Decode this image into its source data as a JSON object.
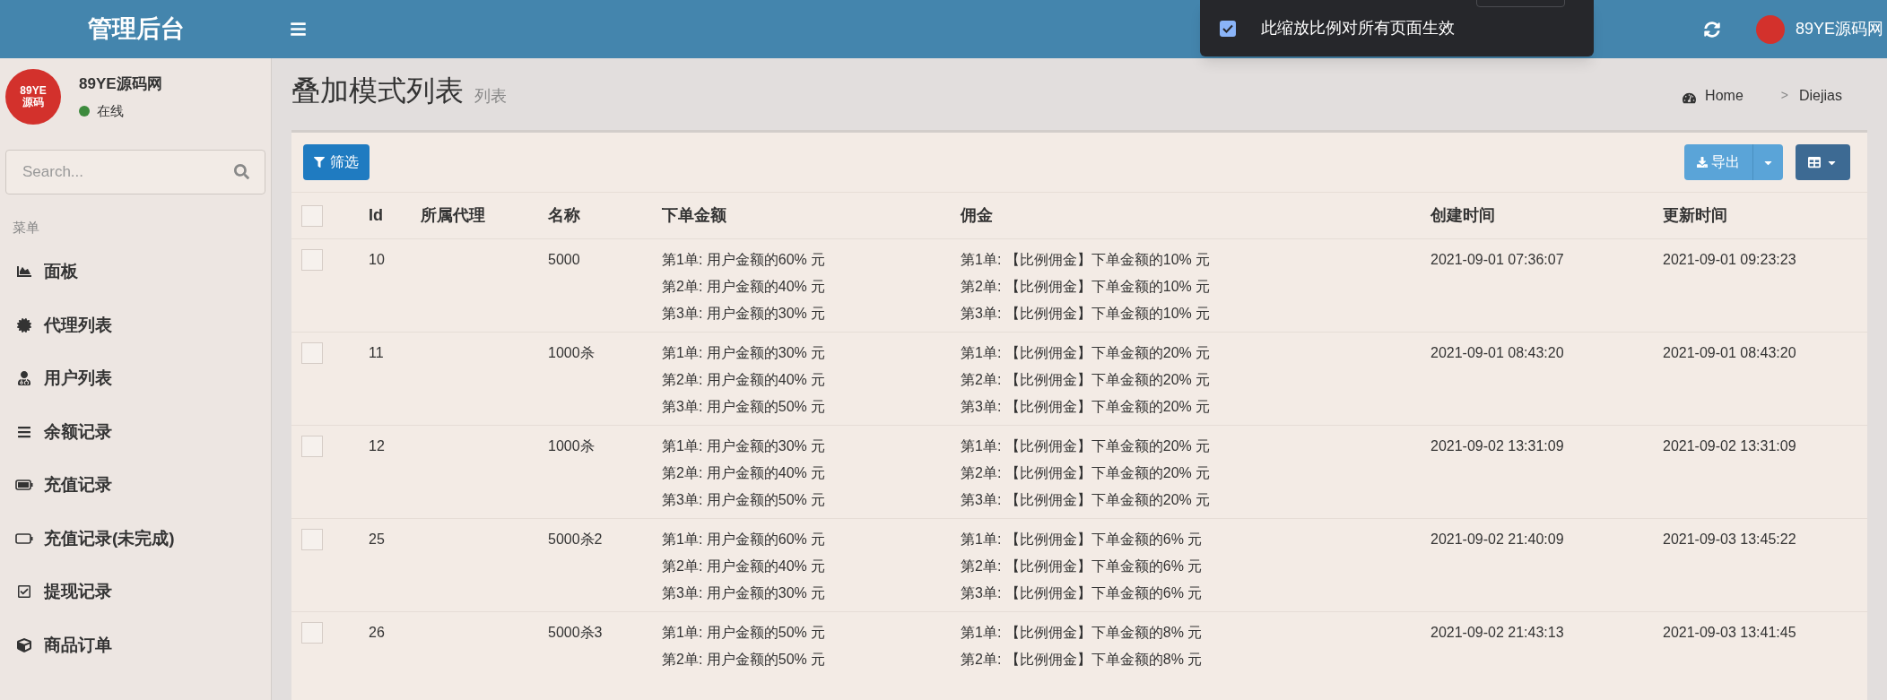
{
  "topbar": {
    "logo": "管理后台",
    "user_name": "89YE源码网"
  },
  "zoom_popup": {
    "checked": true,
    "label": "此缩放比例对所有页面生效"
  },
  "sidebar": {
    "user": {
      "avatar_text": "89YE源码",
      "name": "89YE源码网",
      "status": "在线",
      "online": true
    },
    "search": {
      "placeholder": "Search..."
    },
    "section": "菜单",
    "items": [
      {
        "label": "面板"
      },
      {
        "label": "代理列表"
      },
      {
        "label": "用户列表"
      },
      {
        "label": "余额记录"
      },
      {
        "label": "充值记录"
      },
      {
        "label": "充值记录(未完成)"
      },
      {
        "label": "提现记录"
      },
      {
        "label": "商品订单"
      }
    ]
  },
  "page": {
    "title": "叠加模式列表",
    "subtitle": "列表",
    "breadcrumb": [
      "Home",
      "Diejias"
    ],
    "separator": ">"
  },
  "toolbar": {
    "filter": "筛选",
    "export": "导出"
  },
  "table": {
    "select_all_checked": false,
    "columns": [
      "Id",
      "所属代理",
      "名称",
      "下单金额",
      "佣金",
      "创建时间",
      "更新时间"
    ],
    "rows": [
      {
        "selected": false,
        "id": "10",
        "agent": "",
        "name": "5000",
        "amounts": [
          "第1单: 用户金额的60% 元",
          "第2单: 用户金额的40% 元",
          "第3单: 用户金额的30% 元"
        ],
        "commissions": [
          "第1单: 【比例佣金】下单金额的10% 元",
          "第2单: 【比例佣金】下单金额的10% 元",
          "第3单: 【比例佣金】下单金额的10% 元"
        ],
        "created": "2021-09-01 07:36:07",
        "updated": "2021-09-01 09:23:23"
      },
      {
        "selected": false,
        "id": "11",
        "agent": "",
        "name": "1000杀",
        "amounts": [
          "第1单: 用户金额的30% 元",
          "第2单: 用户金额的40% 元",
          "第3单: 用户金额的50% 元"
        ],
        "commissions": [
          "第1单: 【比例佣金】下单金额的20% 元",
          "第2单: 【比例佣金】下单金额的20% 元",
          "第3单: 【比例佣金】下单金额的20% 元"
        ],
        "created": "2021-09-01 08:43:20",
        "updated": "2021-09-01 08:43:20"
      },
      {
        "selected": false,
        "id": "12",
        "agent": "",
        "name": "1000杀",
        "amounts": [
          "第1单: 用户金额的30% 元",
          "第2单: 用户金额的40% 元",
          "第3单: 用户金额的50% 元"
        ],
        "commissions": [
          "第1单: 【比例佣金】下单金额的20% 元",
          "第2单: 【比例佣金】下单金额的20% 元",
          "第3单: 【比例佣金】下单金额的20% 元"
        ],
        "created": "2021-09-02 13:31:09",
        "updated": "2021-09-02 13:31:09"
      },
      {
        "selected": false,
        "id": "25",
        "agent": "",
        "name": "5000杀2",
        "amounts": [
          "第1单: 用户金额的60% 元",
          "第2单: 用户金额的40% 元",
          "第3单: 用户金额的30% 元"
        ],
        "commissions": [
          "第1单: 【比例佣金】下单金额的6% 元",
          "第2单: 【比例佣金】下单金额的6% 元",
          "第3单: 【比例佣金】下单金额的6% 元"
        ],
        "created": "2021-09-02 21:40:09",
        "updated": "2021-09-03 13:45:22"
      },
      {
        "selected": false,
        "id": "26",
        "agent": "",
        "name": "5000杀3",
        "amounts": [
          "第1单: 用户金额的50% 元",
          "第2单: 用户金额的50% 元"
        ],
        "commissions": [
          "第1单: 【比例佣金】下单金额的8% 元",
          "第2单: 【比例佣金】下单金额的8% 元"
        ],
        "created": "2021-09-02 21:43:13",
        "updated": "2021-09-03 13:41:45"
      }
    ]
  }
}
